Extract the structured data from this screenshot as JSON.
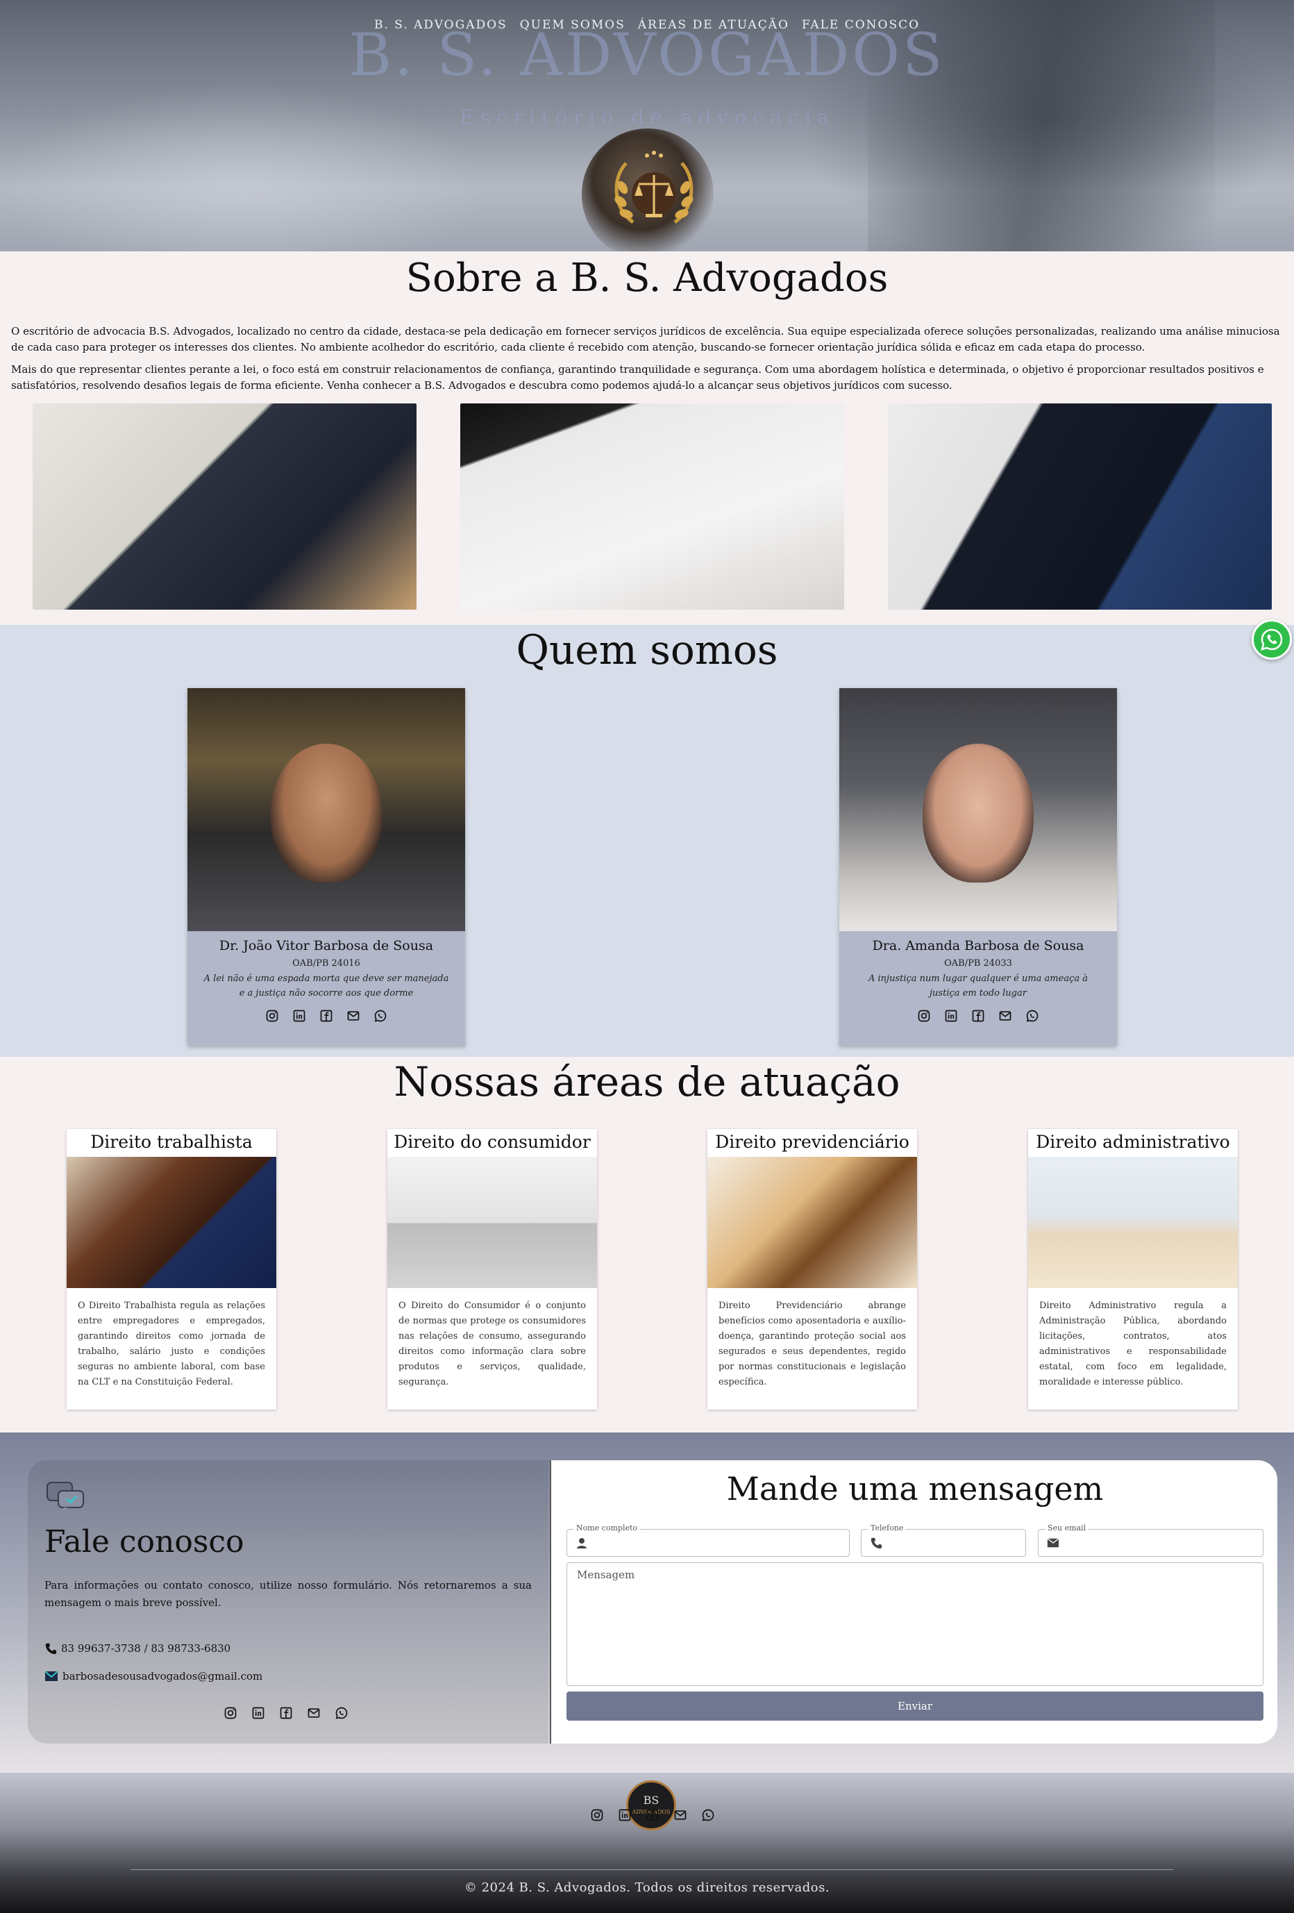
{
  "nav": {
    "items": [
      "B. S. ADVOGADOS",
      "QUEM SOMOS",
      "ÁREAS DE ATUAÇÃO",
      "FALE CONOSCO"
    ]
  },
  "hero": {
    "title": "B. S. ADVOGADOS",
    "subtitle": "Escritório de advocacia",
    "logo_icon": "scales-of-justice-laurel-icon"
  },
  "sobre": {
    "title": "Sobre a B. S. Advogados",
    "p1": "O escritório de advocacia B.S. Advogados, localizado no centro da cidade, destaca-se pela dedicação em fornecer serviços jurídicos de excelência. Sua equipe especializada oferece soluções personalizadas, realizando uma análise minuciosa de cada caso para proteger os interesses dos clientes. No ambiente acolhedor do escritório, cada cliente é recebido com atenção, buscando-se fornecer orientação jurídica sólida e eficaz em cada etapa do processo.",
    "p2": "Mais do que representar clientes perante a lei, o foco está em construir relacionamentos de confiança, garantindo tranquilidade e segurança. Com uma abordagem holística e determinada, o objetivo é proporcionar resultados positivos e satisfatórios, resolvendo desafios legais de forma eficiente. Venha conhecer a B.S. Advogados e descubra como podemos ajudá-lo a alcançar seus objetivos jurídicos com sucesso."
  },
  "quem_somos": {
    "title": "Quem somos",
    "members": [
      {
        "name": "Dr. João Vitor Barbosa de Sousa",
        "oab": "OAB/PB 24016",
        "quote": "A lei não é uma espada morta que deve ser manejada e a justiça não socorre aos que dorme"
      },
      {
        "name": "Dra. Amanda Barbosa de Sousa",
        "oab": "OAB/PB 24033",
        "quote": "A injustiça num lugar qualquer é uma ameaça à justiça em todo lugar"
      }
    ]
  },
  "areas": {
    "title": "Nossas áreas de atuação",
    "items": [
      {
        "title": "Direito trabalhista",
        "text": "O Direito Trabalhista regula as relações entre empregadores e empregados, garantindo direitos como jornada de trabalho, salário justo e condições seguras no ambiente laboral, com base na CLT e na Constituição Federal."
      },
      {
        "title": "Direito do consumidor",
        "text": "O Direito do Consumidor é o conjunto de normas que protege os consumidores nas relações de consumo, assegurando direitos como informação clara sobre produtos e serviços, qualidade, segurança."
      },
      {
        "title": "Direito previdenciário",
        "text": "Direito Previdenciário abrange benefícios como aposentadoria e auxílio-doença, garantindo proteção social aos segurados e seus dependentes, regido por normas constitucionais e legislação específica."
      },
      {
        "title": "Direito administrativo",
        "text": "Direito Administrativo regula a Administração Pública, abordando licitações, contratos, atos administrativos e responsabilidade estatal, com foco em legalidade, moralidade e interesse público."
      }
    ]
  },
  "contato": {
    "title": "Fale conosco",
    "text": "Para informações ou contato conosco, utilize nosso formulário. Nós retornaremos a sua mensagem o mais breve possível.",
    "phone": "83 99637-3738 / 83 98733-6830",
    "email": "barbosadesousadvogados@gmail.com"
  },
  "form": {
    "title": "Mande uma mensagem",
    "name_label": "Nome completo",
    "phone_label": "Telefone",
    "email_label": "Seu email",
    "message_placeholder": "Mensagem",
    "submit_label": "Enviar"
  },
  "footer": {
    "logo_text": "BS",
    "logo_sub": "ADVOGADOS",
    "copyright": "© 2024 B. S. Advogados. Todos os direitos reservados."
  },
  "social_icons": [
    "instagram-icon",
    "linkedin-icon",
    "facebook-icon",
    "mail-icon",
    "whatsapp-icon"
  ],
  "colors": {
    "accent": "#707891",
    "section_bg": "#d7dde9",
    "card_bg": "#b2b7c9",
    "whatsapp": "#2fbe4a"
  }
}
